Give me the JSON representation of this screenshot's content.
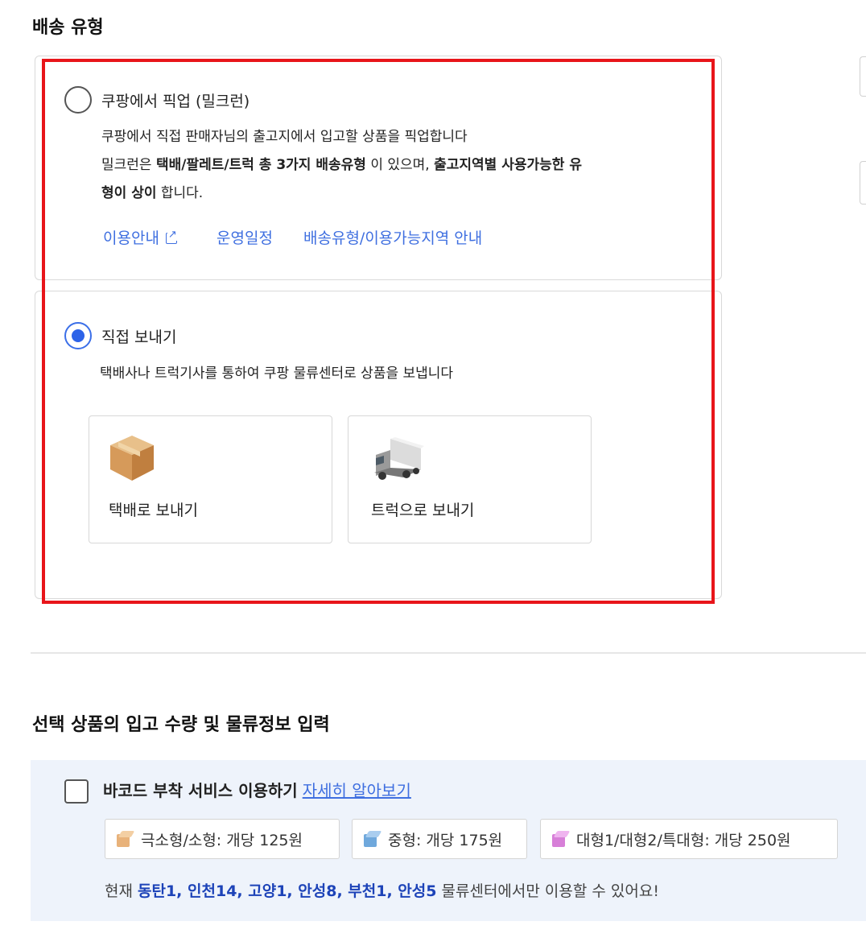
{
  "shipping_type": {
    "title": "배송 유형",
    "pickup_option": {
      "label": "쿠팡에서 픽업 (밀크런)",
      "desc_line1": "쿠팡에서 직접 판매자님의 출고지에서 입고할 상품을 픽업합니다",
      "desc_line2_a": "밀크런은 ",
      "desc_line2_b": "택배/팔레트/트럭 총 3가지 배송유형",
      "desc_line2_c": " 이 있으며, ",
      "desc_line2_d": "출고지역별 사용가능한 유",
      "desc_line3_a": "형이 상이",
      "desc_line3_b": " 합니다.",
      "links": [
        "이용안내",
        "운영일정",
        "배송유형/이용가능지역 안내"
      ],
      "selected": false
    },
    "direct_option": {
      "label": "직접 보내기",
      "desc": "택배사나 트럭기사를 통하여 쿠팡 물류센터로 상품을 보냅니다",
      "selected": true,
      "methods": [
        "택배로 보내기",
        "트럭으로 보내기"
      ]
    }
  },
  "inbound_info": {
    "title": "선택 상품의 입고 수량 및 물류정보 입력",
    "barcode_service_label": "바코드 부착 서비스 이용하기",
    "barcode_service_link": "자세히 알아보기",
    "barcode_service_checked": false,
    "prices": [
      {
        "label": "극소형/소형: 개당 125원",
        "color": "#e8b27a",
        "color_top": "#f3cfa3"
      },
      {
        "label": "중형: 개당 175원",
        "color": "#6fa8dc",
        "color_top": "#a9cdef"
      },
      {
        "label": "대형1/대형2/특대형: 개당 250원",
        "color": "#d77fd8",
        "color_top": "#efb4ef"
      }
    ],
    "centers_prefix": "현재 ",
    "centers_highlight": "동탄1, 인천14, 고양1, 안성8, 부천1, 안성5",
    "centers_suffix": " 물류센터에서만 이용할 수 있어요!"
  },
  "colors": {
    "accent": "#2d63e8",
    "link": "#3f6fe0",
    "highlight_box": "#e8151a",
    "panel_bg": "#eef3fb"
  }
}
